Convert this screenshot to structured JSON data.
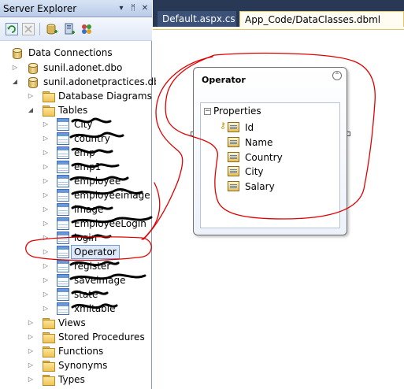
{
  "server_explorer": {
    "title": "Server Explorer",
    "pin_glyph": "▾",
    "autohide_glyph": "ᛗ",
    "close_glyph": "✕",
    "toolbar": [
      "refresh-icon",
      "stop-icon",
      "connect-database-icon",
      "connect-server-icon",
      "add-sharepoint-icon"
    ]
  },
  "tree": {
    "data_connections": "Data Connections",
    "conn1": "sunil.adonet.dbo",
    "conn2": "sunil.adonetpractices.dbo",
    "database_diagrams": "Database Diagrams",
    "tables": "Tables",
    "table_items": [
      "City",
      "country",
      "emp",
      "emp1",
      "employee",
      "employeeimage",
      "image",
      "EmployeeLogin",
      "login",
      "Operator",
      "register",
      "saveimage",
      "state",
      "xmltable"
    ],
    "views": "Views",
    "stored_procedures": "Stored Procedures",
    "functions": "Functions",
    "synonyms": "Synonyms",
    "types": "Types"
  },
  "tabs": {
    "default": "Default.aspx.cs",
    "dataclasses": "App_Code/DataClasses.dbml"
  },
  "entity": {
    "name": "Operator",
    "collapse_glyph": "⌃",
    "section": "Properties",
    "properties": [
      "Id",
      "Name",
      "Country",
      "City",
      "Salary"
    ]
  },
  "colors": {
    "annotation": "#e00000",
    "scribble": "#000000",
    "tab_bar": "#293955",
    "active_tab": "#fffcf4"
  }
}
